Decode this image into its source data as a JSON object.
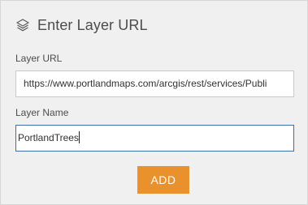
{
  "panel": {
    "title": "Enter Layer URL",
    "title_icon": "layers-icon"
  },
  "fields": {
    "url_label": "Layer URL",
    "url_value": "https://www.portlandmaps.com/arcgis/rest/services/Publi",
    "name_label": "Layer Name",
    "name_value": "PortlandTrees"
  },
  "actions": {
    "add_label": "ADD"
  },
  "colors": {
    "accent": "#e8912d",
    "focus_border": "#3d6fa6",
    "panel_bg": "#f0f0f0"
  }
}
